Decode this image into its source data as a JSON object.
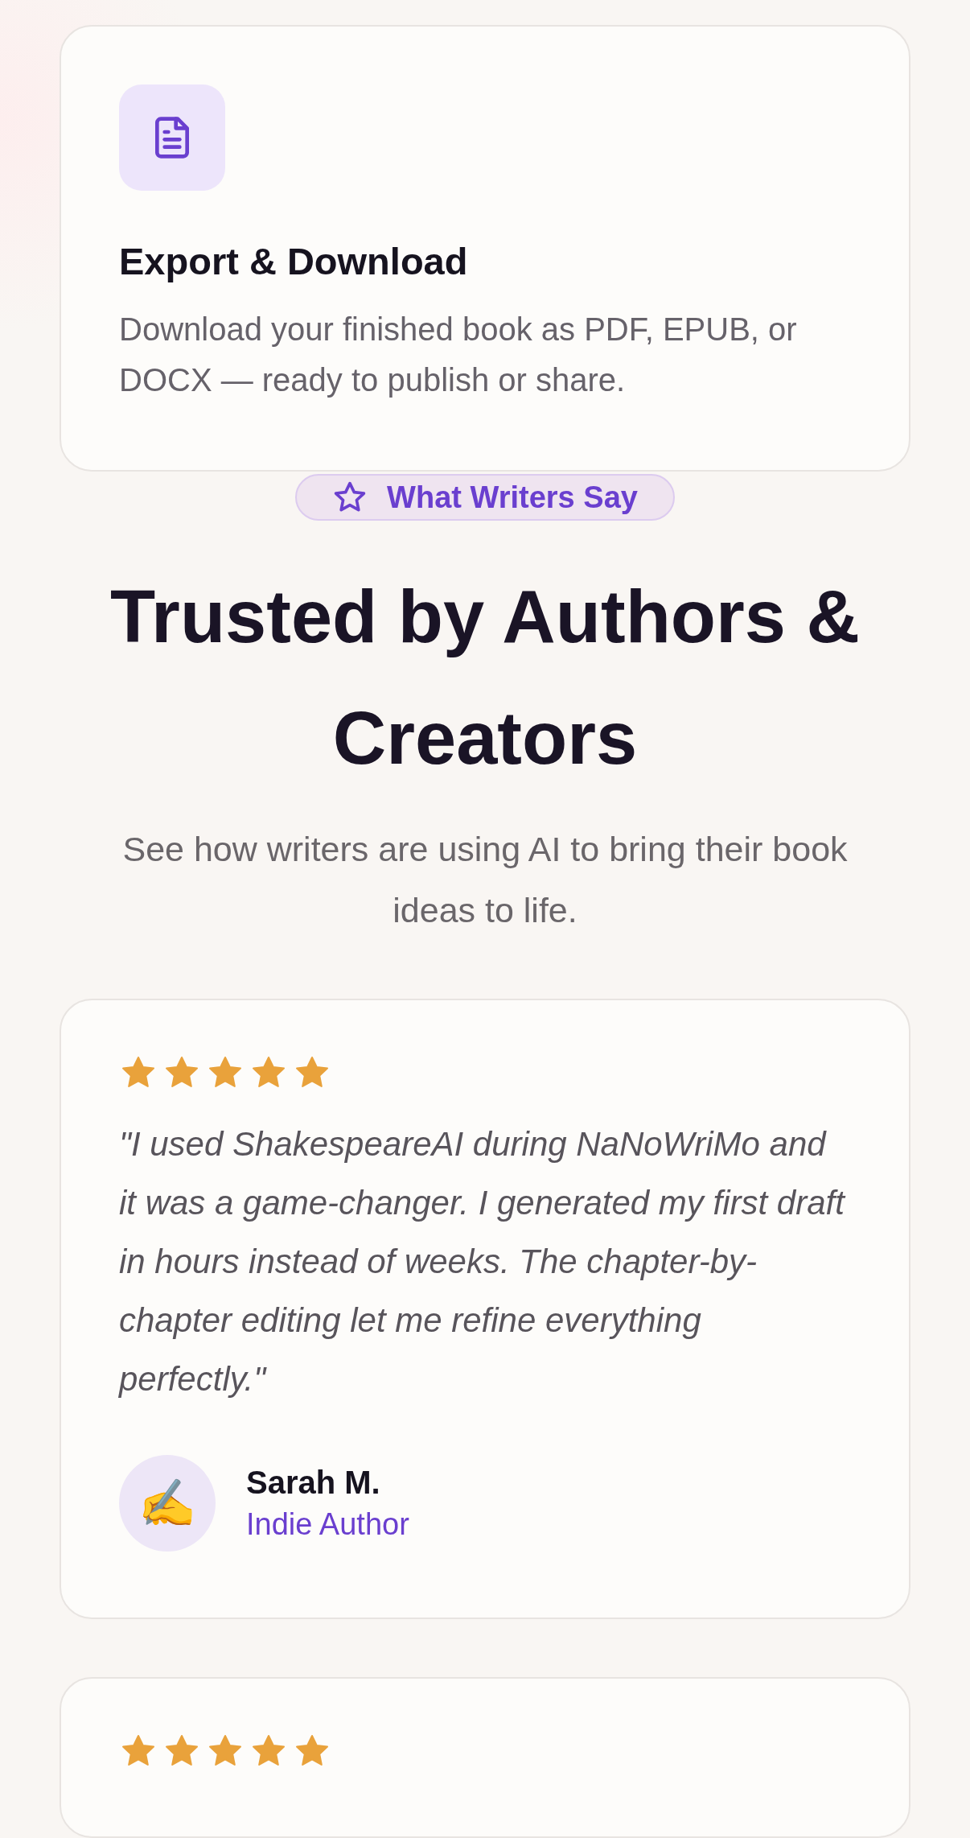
{
  "feature_card": {
    "title": "Export & Download",
    "description": "Download your finished book as PDF, EPUB, or DOCX — ready to publish or share."
  },
  "section_badge": {
    "label": "What Writers Say"
  },
  "heading": "Trusted by Authors & Creators",
  "subheading": "See how writers are using AI to bring their book ideas to life.",
  "testimonials": [
    {
      "stars": 5,
      "quote": "\"I used ShakespeareAI during NaNoWriMo and it was a game-changer. I generated my first draft in hours instead of weeks. The chapter-by-chapter editing let me refine everything perfectly.\"",
      "avatar": "✍️",
      "name": "Sarah M.",
      "role": "Indie Author"
    },
    {
      "stars": 5
    }
  ]
}
